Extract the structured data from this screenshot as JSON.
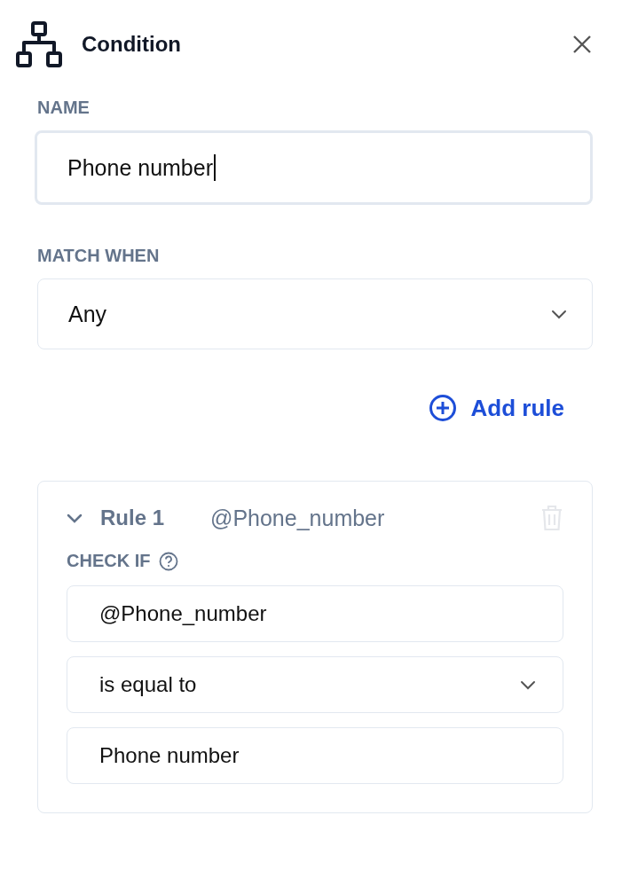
{
  "header": {
    "title": "Condition"
  },
  "name_field": {
    "label": "NAME",
    "value": "Phone number",
    "focused": true
  },
  "match_field": {
    "label": "MATCH WHEN",
    "value": "Any"
  },
  "add_rule": {
    "label": "Add rule"
  },
  "rules": [
    {
      "title": "Rule 1",
      "subtitle": "@Phone_number",
      "expanded": true,
      "delete_disabled": true,
      "check_label": "CHECK IF",
      "fields": [
        {
          "kind": "text",
          "value": "@Phone_number"
        },
        {
          "kind": "select",
          "value": "is equal to"
        },
        {
          "kind": "text",
          "value": "Phone number"
        }
      ]
    }
  ]
}
